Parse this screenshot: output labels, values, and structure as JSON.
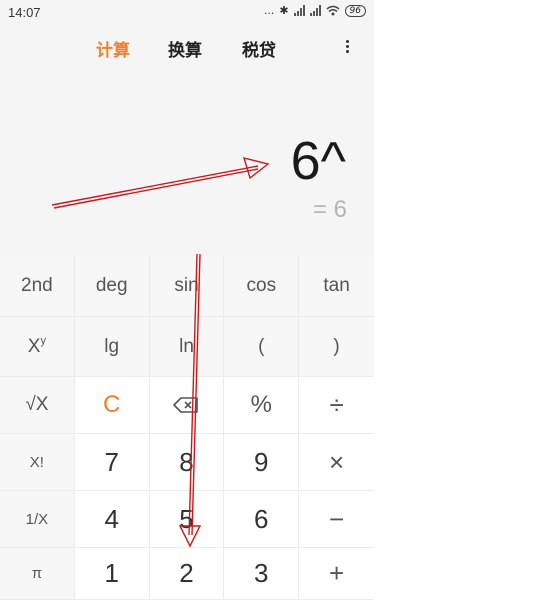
{
  "status_bar": {
    "time": "14:07",
    "dots": "...",
    "bluetooth": "✱",
    "battery": "96"
  },
  "tabs": [
    {
      "label": "计算",
      "active": true
    },
    {
      "label": "换算",
      "active": false
    },
    {
      "label": "税贷",
      "active": false
    }
  ],
  "display": {
    "expression": "6^",
    "result": "= 6"
  },
  "keypad": {
    "row1": [
      "2nd",
      "deg",
      "sin",
      "cos",
      "tan"
    ],
    "row2": {
      "xy_base": "X",
      "xy_exp": "y",
      "lg": "lg",
      "ln": "ln",
      "paren_open": "(",
      "paren_close": ")"
    },
    "row3": {
      "sqrt": "√X",
      "clear": "C",
      "percent": "%",
      "divide": "÷"
    },
    "row4": {
      "factorial": "X!",
      "seven": "7",
      "eight": "8",
      "nine": "9",
      "multiply": "×"
    },
    "row5": {
      "reciprocal": "1/X",
      "four": "4",
      "five": "5",
      "six": "6",
      "minus": "−"
    },
    "row6": {
      "pi": "π",
      "one": "1",
      "two": "2",
      "three": "3",
      "plus": "+"
    }
  },
  "colors": {
    "accent": "#f07f2f",
    "annotation": "#cc1a1a"
  },
  "icons": {
    "backspace": "backspace-icon",
    "menu": "more-vertical-icon"
  }
}
